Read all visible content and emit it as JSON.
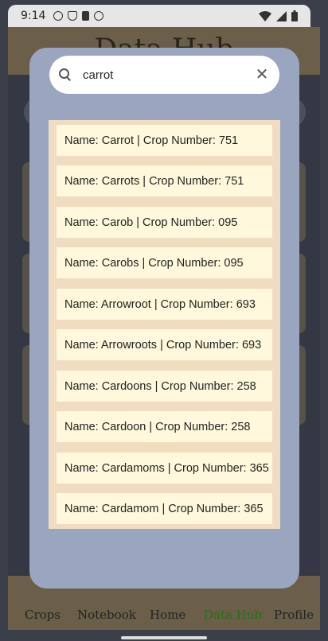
{
  "status_bar": {
    "time": "9:14",
    "left_icons": [
      "info-icon",
      "shield-icon",
      "sim-icon",
      "face-icon"
    ],
    "right_icons": [
      "wifi-icon",
      "signal-icon",
      "battery-icon"
    ]
  },
  "app": {
    "title": "Data Hub"
  },
  "bottom_nav": {
    "items": [
      {
        "label": "Crops"
      },
      {
        "label": "Notebook"
      },
      {
        "label": "Home"
      },
      {
        "label": "Data Hub"
      },
      {
        "label": "Profile"
      }
    ],
    "active_color": "#2e6b1c"
  },
  "search": {
    "value": "carrot",
    "placeholder": ""
  },
  "results": [
    {
      "text": "Name: Carrot | Crop Number: 751"
    },
    {
      "text": "Name: Carrots | Crop Number: 751"
    },
    {
      "text": "Name: Carob | Crop Number: 095"
    },
    {
      "text": "Name: Carobs | Crop Number: 095"
    },
    {
      "text": "Name: Arrowroot | Crop Number: 693"
    },
    {
      "text": "Name: Arrowroots | Crop Number: 693"
    },
    {
      "text": "Name: Cardoons | Crop Number: 258"
    },
    {
      "text": "Name: Cardoon | Crop Number: 258"
    },
    {
      "text": "Name: Cardamoms | Crop Number: 365"
    },
    {
      "text": "Name: Cardamom | Crop Number: 365"
    }
  ],
  "colors": {
    "dialog_bg": "#9aa6bf",
    "results_bg": "#f0dcc0",
    "item_bg": "#fff8dc",
    "header_bg": "#6b5f4a"
  }
}
